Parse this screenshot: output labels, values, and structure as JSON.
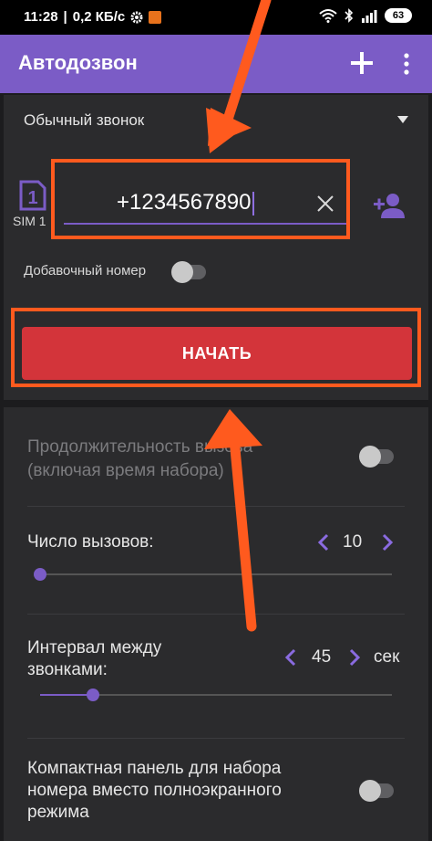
{
  "status_bar": {
    "time": "11:28",
    "network_speed": "0,2 КБ/с",
    "battery": "63"
  },
  "app_bar": {
    "title": "Автодозвон"
  },
  "dialer": {
    "call_type": "Обычный звонок",
    "sim_label": "SIM 1",
    "sim_number": "1",
    "phone_value": "+1234567890",
    "extension_label": "Добавочный номер",
    "extension_enabled": false,
    "start_label": "НАЧАТЬ"
  },
  "settings": {
    "duration": {
      "line1": "Продолжительность вызова",
      "line2": "(включая время набора)",
      "enabled": false
    },
    "call_count": {
      "label": "Число вызовов:",
      "value": "10"
    },
    "interval": {
      "line1": "Интервал между",
      "line2": "звонками:",
      "value": "45",
      "unit": "сек"
    },
    "compact": {
      "line1": "Компактная панель для набора",
      "line2": "номера вместо полноэкранного",
      "line3": "режима",
      "enabled": false
    }
  },
  "colors": {
    "accent": "#7b5cc6",
    "start_button": "#d3343a",
    "annotation": "#ff5a1e"
  },
  "icons": [
    "gear-icon",
    "wifi-icon",
    "bluetooth-icon",
    "signal-icon",
    "add-icon",
    "more-icon",
    "dropdown-icon",
    "sim-icon",
    "clear-icon",
    "add-contact-icon",
    "chevron-left-icon",
    "chevron-right-icon"
  ]
}
